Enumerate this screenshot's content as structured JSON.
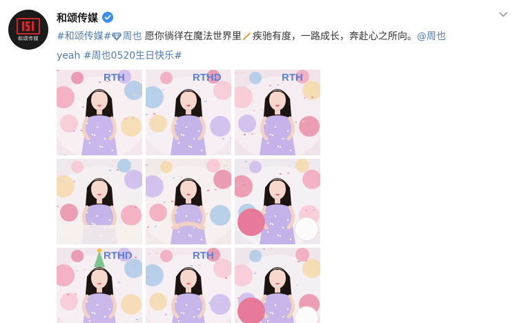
{
  "post": {
    "author": {
      "name": "和颂传媒",
      "avatar_text": "和颂传媒",
      "verified_icon": "verified-badge-icon"
    },
    "more_icon": "chevron-down-icon",
    "text": {
      "hashtag_1": "#和颂传媒#",
      "mention_1": "周也",
      "body": " 愿你徜徉在魔法世界里",
      "body_2": "疾驰有度，一路成长，奔赴心之所向。",
      "mention_2": "@周也",
      "line2_start": "yeah",
      "hashtag_2": "#周也0520生日快乐#"
    },
    "images": [
      {
        "name": "photo-1",
        "bg": "#f3e6ec",
        "banner": "RTH",
        "dress": "#c9b6ec",
        "hair": "#1d1512",
        "pose": "center"
      },
      {
        "name": "photo-2",
        "bg": "#f2e9ee",
        "banner": "RTHD",
        "dress": "#c5b4ea",
        "hair": "#1d1512",
        "pose": "center"
      },
      {
        "name": "photo-3",
        "bg": "#f0e4ea",
        "banner": "RTH",
        "dress": "#c7b3ea",
        "hair": "#1d1512",
        "pose": "center"
      },
      {
        "name": "photo-4",
        "bg": "#efe8ec",
        "banner": "",
        "dress": "#c4b4ea",
        "hair": "#1b1411",
        "pose": "lean"
      },
      {
        "name": "photo-5",
        "bg": "#f1eae9",
        "banner": "",
        "dress": "#c8b8ea",
        "hair": "#1b1411",
        "pose": "arms"
      },
      {
        "name": "photo-6",
        "bg": "#eee9ee",
        "banner": "",
        "dress": "#c4b3ea",
        "hair": "#1b1411",
        "pose": "balloon"
      },
      {
        "name": "photo-7",
        "bg": "#f0e6ee",
        "banner": "RTHD",
        "dress": "#cbb8ea",
        "hair": "#1b1411",
        "pose": "hat"
      },
      {
        "name": "photo-8",
        "bg": "#f2e8ee",
        "banner": "RTH",
        "dress": "#c7b6ea",
        "hair": "#1b1411",
        "pose": "center"
      },
      {
        "name": "photo-9",
        "bg": "#efe6ec",
        "banner": "",
        "dress": "#c8b6ea",
        "hair": "#1b1411",
        "pose": "balloon"
      }
    ]
  },
  "colors": {
    "link": "#4f7db5",
    "text": "#333333",
    "verified": "#3d8ee8",
    "logo_red": "#d3272b"
  }
}
